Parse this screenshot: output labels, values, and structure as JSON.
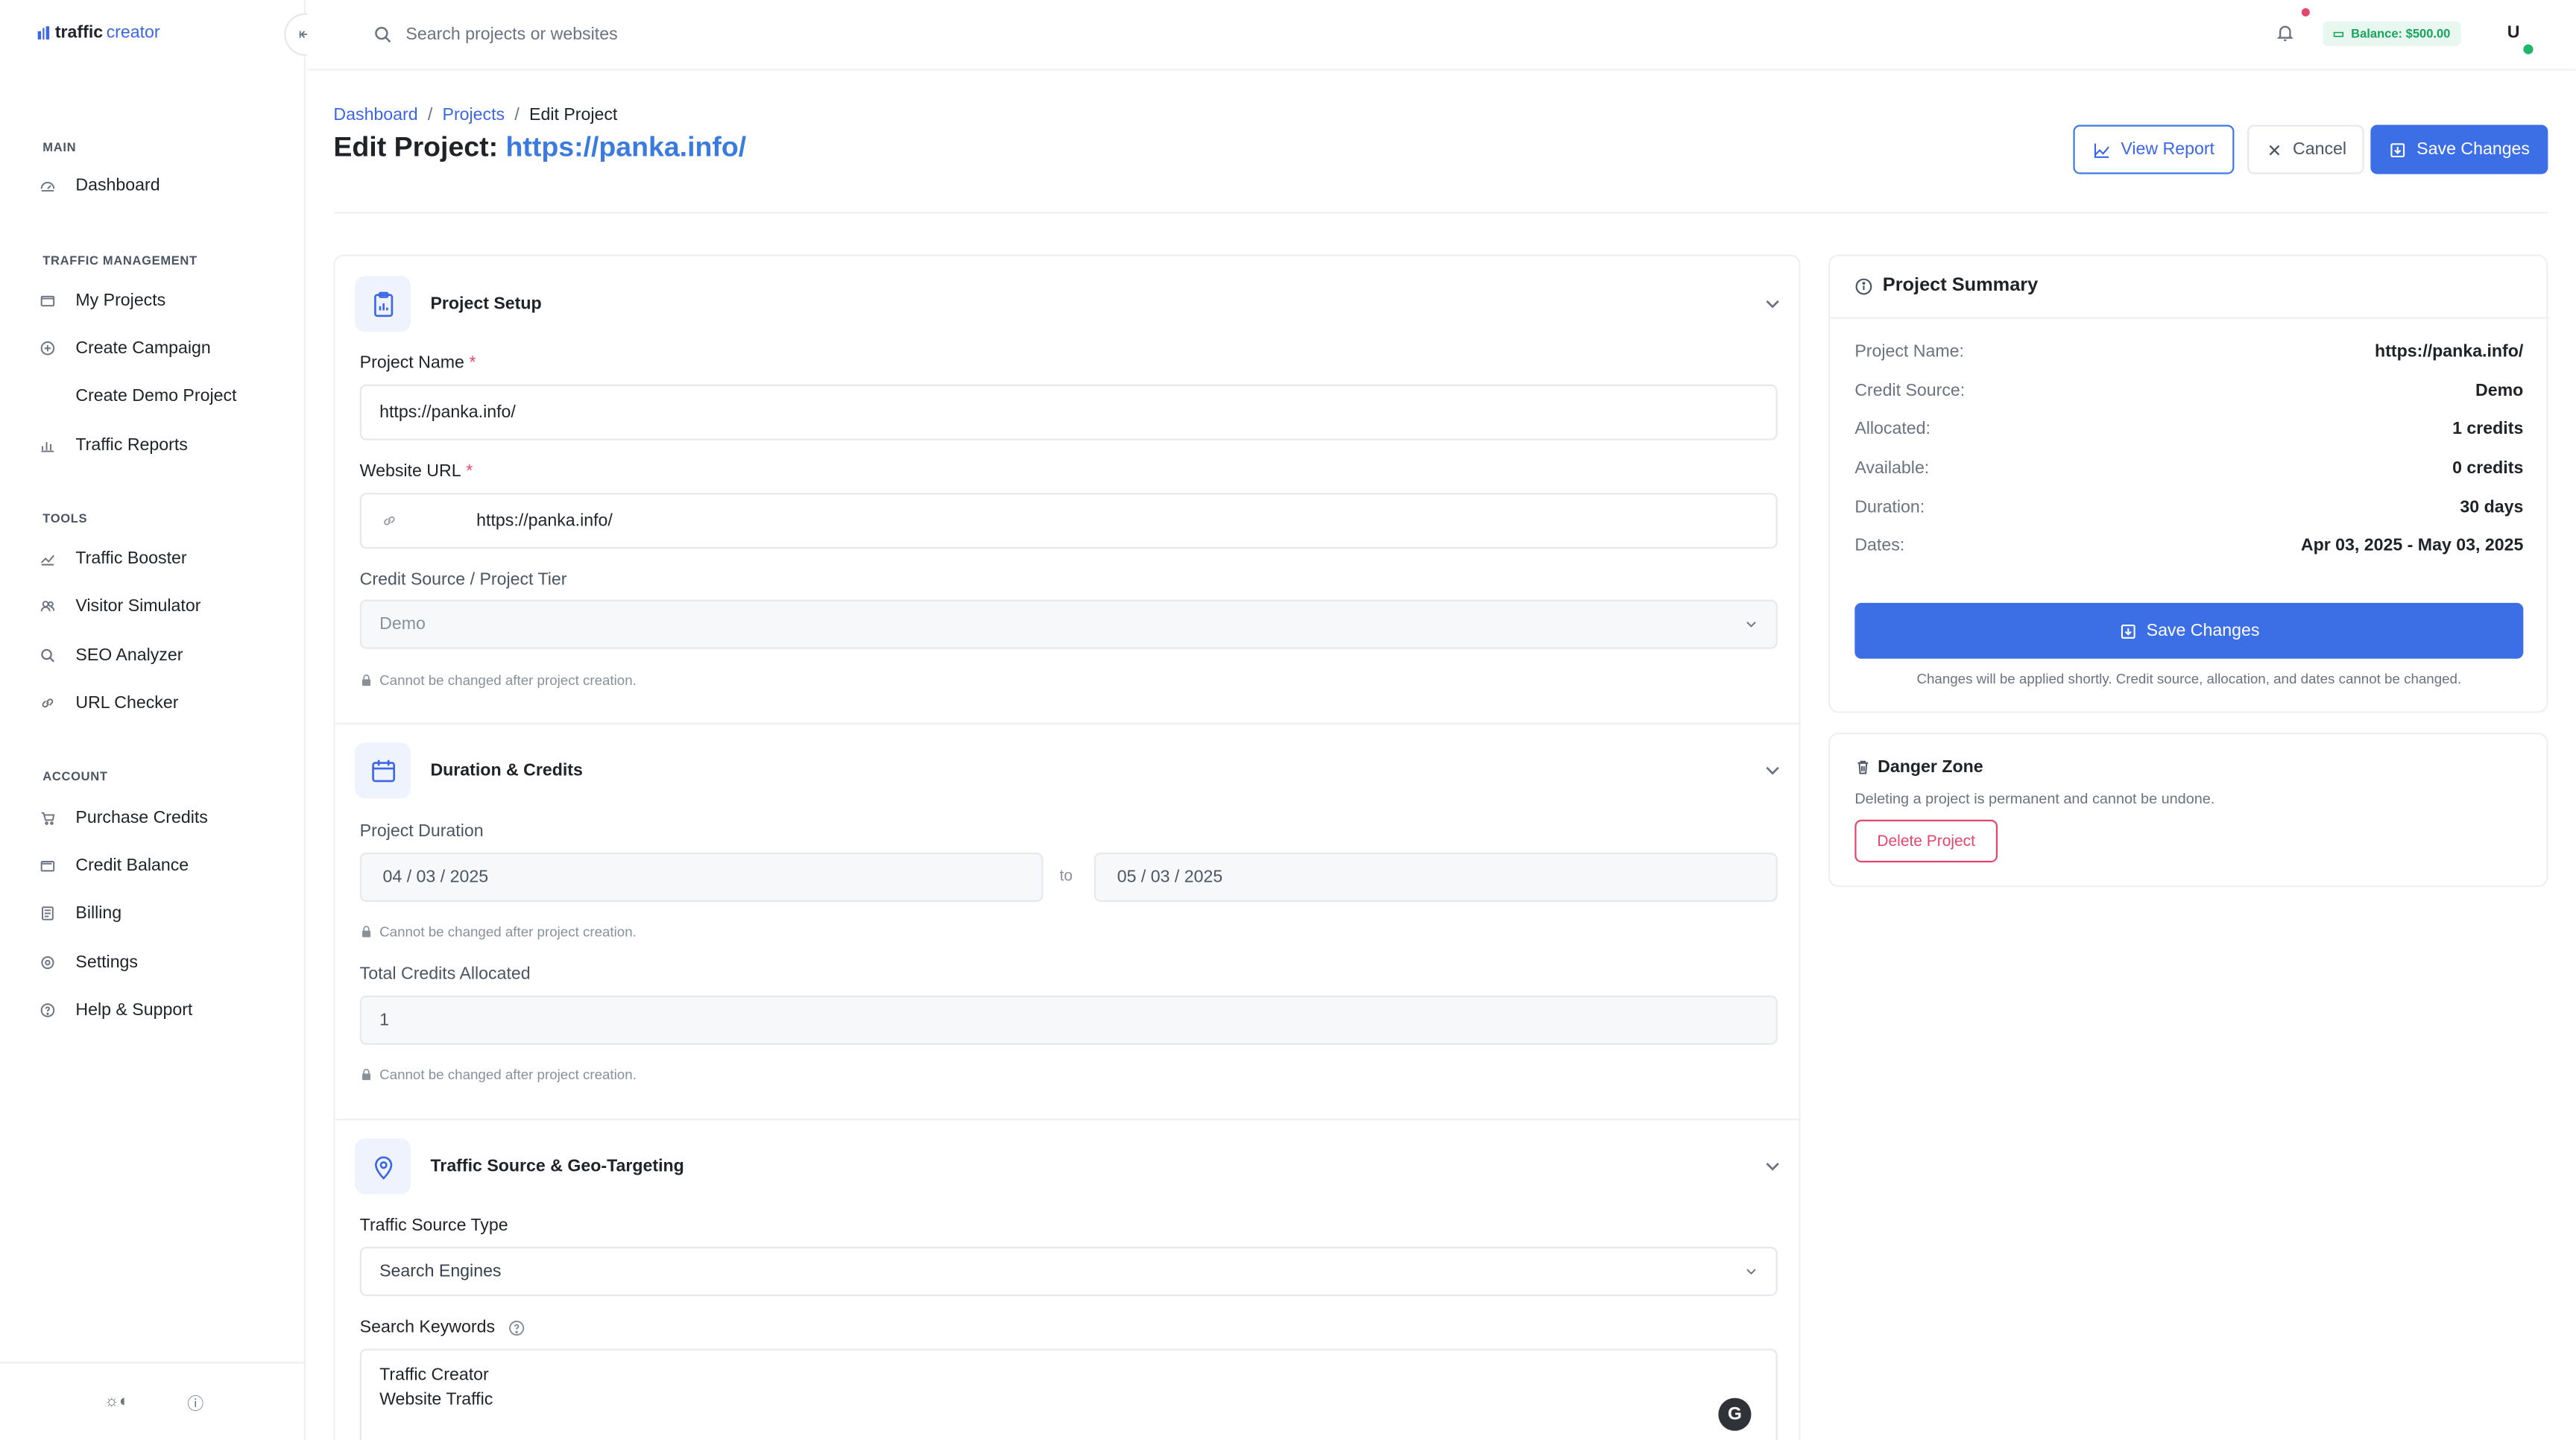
{
  "app": {
    "logo_bold": "traffic",
    "logo_light": "creator"
  },
  "sidebar": {
    "sections": [
      {
        "title": "MAIN",
        "items": [
          {
            "label": "Dashboard",
            "icon": "dashboard-icon"
          }
        ]
      },
      {
        "title": "TRAFFIC MANAGEMENT",
        "items": [
          {
            "label": "My Projects",
            "icon": "folder-icon"
          },
          {
            "label": "Create Campaign",
            "icon": "plus-circle-icon"
          },
          {
            "label": "Create Demo Project",
            "icon": ""
          },
          {
            "label": "Traffic Reports",
            "icon": "bar-chart-icon"
          }
        ]
      },
      {
        "title": "TOOLS",
        "items": [
          {
            "label": "Traffic Booster",
            "icon": "trend-icon"
          },
          {
            "label": "Visitor Simulator",
            "icon": "users-icon"
          },
          {
            "label": "SEO Analyzer",
            "icon": "search-icon"
          },
          {
            "label": "URL Checker",
            "icon": "link-icon"
          }
        ]
      },
      {
        "title": "ACCOUNT",
        "items": [
          {
            "label": "Purchase Credits",
            "icon": "cart-icon"
          },
          {
            "label": "Credit Balance",
            "icon": "wallet-icon"
          },
          {
            "label": "Billing",
            "icon": "receipt-icon"
          },
          {
            "label": "Settings",
            "icon": "gear-icon"
          },
          {
            "label": "Help & Support",
            "icon": "help-icon"
          }
        ]
      }
    ]
  },
  "topbar": {
    "search_placeholder": "Search projects or websites",
    "balance": "Balance: $500.00",
    "avatar_initial": "U"
  },
  "breadcrumb": {
    "items": [
      "Dashboard",
      "Projects",
      "Edit Project"
    ],
    "separator": "/"
  },
  "page": {
    "title_prefix": "Edit Project:",
    "title_url": "https://panka.info/"
  },
  "actions": {
    "view_report": "View Report",
    "cancel": "Cancel",
    "save": "Save Changes"
  },
  "form": {
    "project_setup": {
      "title": "Project Setup",
      "project_name_label": "Project Name",
      "project_name_value": "https://panka.info/",
      "website_url_label": "Website URL",
      "website_url_value": "https://panka.info/",
      "credit_source_label": "Credit Source / Project Tier",
      "credit_source_value": "Demo",
      "note": "Cannot be changed after project creation."
    },
    "duration_credits": {
      "title": "Duration & Credits",
      "duration_label": "Project Duration",
      "start_date": "04 / 03 / 2025",
      "to": "to",
      "end_date": "05 / 03 / 2025",
      "note": "Cannot be changed after project creation.",
      "credits_label": "Total Credits Allocated",
      "credits_value": "1",
      "credits_note": "Cannot be changed after project creation."
    },
    "traffic_source": {
      "title": "Traffic Source & Geo-Targeting",
      "source_type_label": "Traffic Source Type",
      "source_type_value": "Search Engines",
      "keywords_label": "Search Keywords",
      "keywords": [
        "Traffic Creator",
        "Website Traffic"
      ],
      "grammarly_letter": "G"
    }
  },
  "summary": {
    "title": "Project Summary",
    "rows": [
      {
        "k": "Project Name:",
        "v": "https://panka.info/"
      },
      {
        "k": "Credit Source:",
        "v": "Demo"
      },
      {
        "k": "Allocated:",
        "v": "1 credits"
      },
      {
        "k": "Available:",
        "v": "0 credits"
      },
      {
        "k": "Duration:",
        "v": "30 days"
      },
      {
        "k": "Dates:",
        "v": "Apr 03, 2025 - May 03, 2025"
      }
    ],
    "save": "Save Changes",
    "note": "Changes will be applied shortly. Credit source, allocation, and dates cannot be changed."
  },
  "danger": {
    "title": "Danger Zone",
    "text": "Deleting a project is permanent and cannot be undone.",
    "button": "Delete Project"
  },
  "colors": {
    "primary": "#3c6ee6",
    "link": "#3b7be0",
    "danger": "#e5466d",
    "success": "#17a45d"
  }
}
